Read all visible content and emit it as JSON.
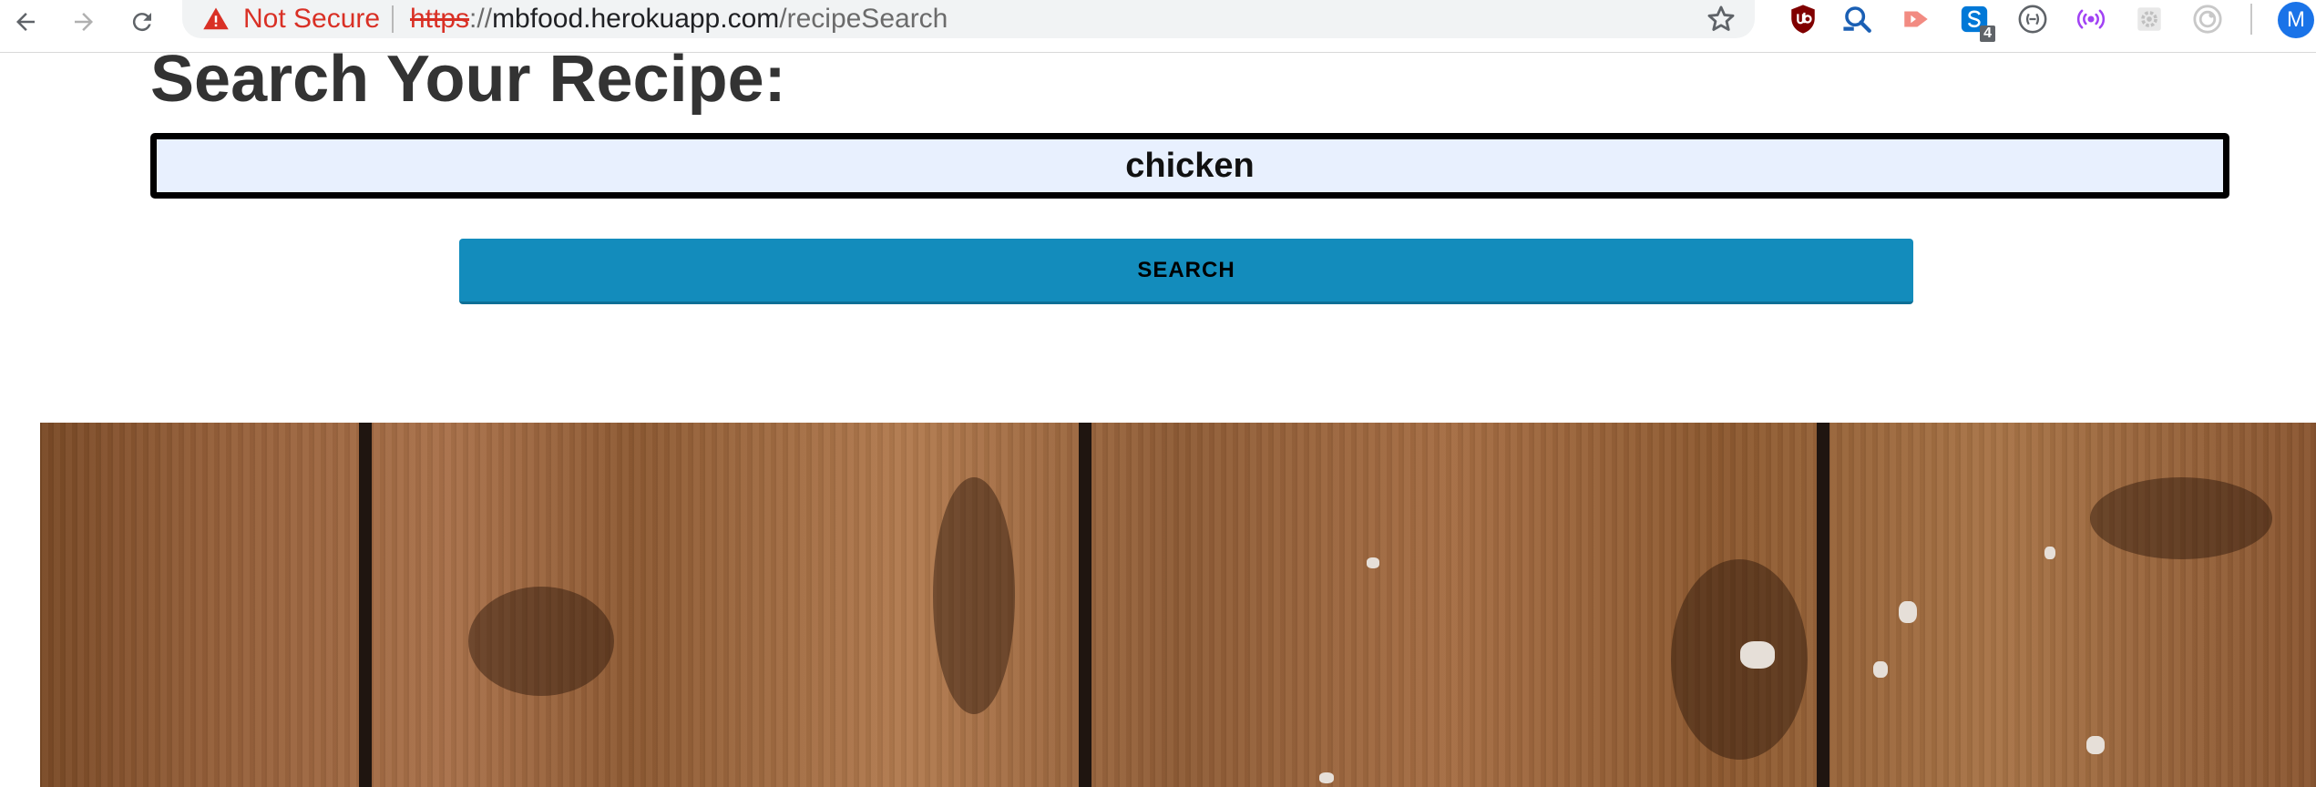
{
  "browser": {
    "security_label": "Not Secure",
    "url": {
      "scheme": "https",
      "separator": "://",
      "host": "mbfood.herokuapp.com",
      "path": "/recipeSearch"
    },
    "nav_icons": [
      "back-arrow-icon",
      "forward-arrow-icon",
      "reload-icon"
    ],
    "extensions": [
      {
        "name": "ublock-icon",
        "color": "#800000"
      },
      {
        "name": "magnifier-extension-icon",
        "color": "#1a5fb4"
      },
      {
        "name": "arrow-extension-icon",
        "color": "#f28b82"
      },
      {
        "name": "skype-extension-icon",
        "color": "#0078d7",
        "badge": "4"
      },
      {
        "name": "bracket-extension-icon",
        "color": "#5f6368"
      },
      {
        "name": "broadcast-extension-icon",
        "color": "#a142f4"
      },
      {
        "name": "gear-extension-icon",
        "color": "#c8c8c8"
      },
      {
        "name": "target-extension-icon",
        "color": "#c8c8c8"
      }
    ],
    "profile_initial": "M"
  },
  "page": {
    "heading": "Search Your Recipe:",
    "search": {
      "value": "chicken",
      "button_label": "SEARCH"
    },
    "colors": {
      "button": "#138cbc",
      "input_bg": "#e8f0fe",
      "heading": "#333333",
      "warning": "#d93025"
    },
    "background_image": "wood-planks"
  }
}
